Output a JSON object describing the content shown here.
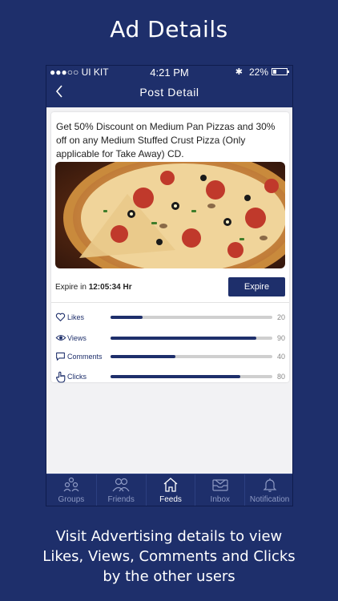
{
  "promo": {
    "title": "Ad Details",
    "caption_lines": [
      "Visit Advertising details to view",
      "Likes, Views, Comments and Clicks",
      "by the other users"
    ]
  },
  "status_bar": {
    "carrier": "●●●○○ UI KIT",
    "time": "4:21 PM",
    "bluetooth_icon": "bluetooth-icon",
    "battery": "22%",
    "battery_level": 0.22
  },
  "nav": {
    "back_icon": "chevron-left-icon",
    "title": "Post Detail"
  },
  "post": {
    "description": "Get  50% Discount on Medium Pan Pizzas and 30% off on any Medium Stuffed Crust Pizza  (Only applicable for Take Away) CD.",
    "image": "pizza-photo",
    "expire_label": "Expire in ",
    "expire_time": "12:05:34 Hr",
    "expire_button": "Expire"
  },
  "stats": [
    {
      "label": "Likes",
      "value": "20",
      "icon": "heart-icon",
      "max": 100
    },
    {
      "label": "Views",
      "value": "90",
      "icon": "eye-icon",
      "max": 100
    },
    {
      "label": "Comments",
      "value": "40",
      "icon": "comment-icon",
      "max": 100
    },
    {
      "label": "Clicks",
      "value": "80",
      "icon": "hand-pointer-icon",
      "max": 100
    }
  ],
  "tabs": [
    {
      "label": "Groups",
      "icon": "groups-icon",
      "active": false
    },
    {
      "label": "Friends",
      "icon": "friends-icon",
      "active": false
    },
    {
      "label": "Feeds",
      "icon": "home-icon",
      "active": true
    },
    {
      "label": "Inbox",
      "icon": "inbox-icon",
      "active": false
    },
    {
      "label": "Notification",
      "icon": "bell-icon",
      "active": false
    }
  ],
  "colors": {
    "navy": "#1e2f6b",
    "bar_track": "#cfcfcf",
    "tab_inactive": "#8e9ac4"
  }
}
